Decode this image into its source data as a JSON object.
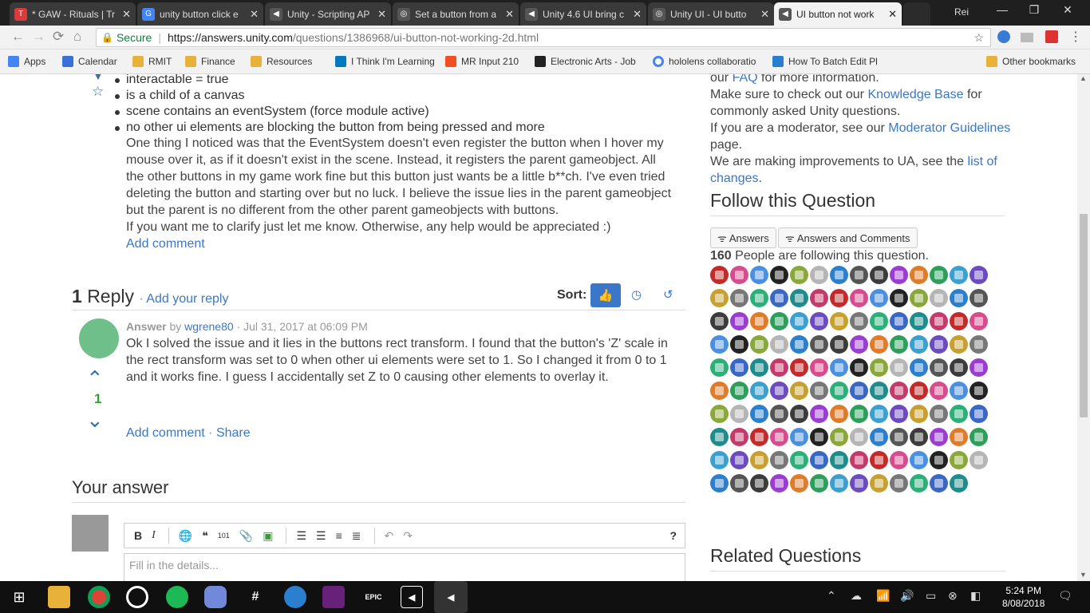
{
  "tabs": [
    {
      "label": "* GAW - Rituals | Tr",
      "color": "#d83b3b",
      "glyph": "T"
    },
    {
      "label": "unity button click e",
      "color": "#4285f4",
      "glyph": "G"
    },
    {
      "label": "Unity - Scripting AP",
      "color": "#555",
      "glyph": "◀"
    },
    {
      "label": "Set a button from a",
      "color": "#555",
      "glyph": "◎"
    },
    {
      "label": "Unity 4.6 UI bring c",
      "color": "#555",
      "glyph": "◀"
    },
    {
      "label": "Unity UI - UI butto",
      "color": "#555",
      "glyph": "◎"
    },
    {
      "label": "UI button not work",
      "color": "#555",
      "glyph": "◀"
    }
  ],
  "profile": "Rei",
  "omnibox": {
    "secure": "Secure",
    "url_host": "https://answers.unity.com",
    "url_path": "/questions/1386968/ui-button-not-working-2d.html"
  },
  "bookmarks": [
    {
      "label": "Apps",
      "kind": "apps"
    },
    {
      "label": "Calendar",
      "kind": "cal"
    },
    {
      "label": "RMIT",
      "kind": "folder"
    },
    {
      "label": "Finance",
      "kind": "folder"
    },
    {
      "label": "Resources",
      "kind": "folder"
    },
    {
      "label": "I Think I'm Learning",
      "kind": "trello"
    },
    {
      "label": "MR Input 210",
      "kind": "ms"
    },
    {
      "label": "Electronic Arts - Job",
      "kind": "ea"
    },
    {
      "label": "hololens collaboratio",
      "kind": "google"
    },
    {
      "label": "How To Batch Edit Pl",
      "kind": "plus"
    },
    {
      "label": "Other bookmarks",
      "kind": "folder"
    }
  ],
  "question": {
    "bullets": [
      "interactable = true",
      "is a child of a canvas",
      "scene contains an eventSystem (force module active)",
      "no other ui elements are blocking the button from being pressed and more"
    ],
    "body": "One thing I noticed was that the EventSystem doesn't even register the button when I hover my mouse over it, as if it doesn't exist in the scene. Instead, it registers the parent gameobject. All the other buttons in my game work fine but this button just wants be a little b**ch. I've even tried deleting the button and starting over but no luck. I believe the issue lies in the parent gameobject but the parent is no different from the other parent gameobjects with buttons.",
    "closing": "If you want me to clarify just let me know. Otherwise, any help would be appreciated :)",
    "add_comment": "Add comment"
  },
  "replies": {
    "count": "1",
    "label": "Reply",
    "add_reply": "Add your reply",
    "sort_label": "Sort:"
  },
  "answer": {
    "kind": "Answer",
    "by": "by",
    "author": "wgrene80",
    "date": "· Jul 31, 2017 at 06:09 PM",
    "text": "Ok I solved the issue and it lies in the buttons rect transform. I found that the button's 'Z' scale in the rect transform was set to 0 when other ui elements were set to 1. So I changed it from 0 to 1 and it works fine. I guess I accidentally set Z to 0 causing other elements to overlay it.",
    "votes": "1",
    "add_comment": "Add comment",
    "share": "Share"
  },
  "your_answer": {
    "heading": "Your answer",
    "placeholder": "Fill in the details..."
  },
  "sidebar": {
    "faq_pre": "our",
    "faq": "FAQ",
    "faq_post": "for more information.",
    "kb_pre": "Make sure to check out our",
    "kb": "Knowledge Base",
    "kb_post": "for commonly asked Unity questions.",
    "mod_pre": "If you are a moderator, see our",
    "mod": "Moderator Guidelines",
    "mod_post": "page.",
    "imp_pre": "We are making improvements to UA, see the",
    "imp": "list of changes",
    "imp_post": ".",
    "follow_heading": "Follow this Question",
    "btn_answers": "Answers",
    "btn_both": "Answers and Comments",
    "followers_count": "160",
    "followers_text": "People are following this question.",
    "related_heading": "Related Questions"
  },
  "avatar_colors": [
    "#2e9e5b",
    "#c8a030",
    "#3a66c4",
    "#c42a2a",
    "#222",
    "#2a7fcf",
    "#9b3dd1",
    "#3aa0d0",
    "#777",
    "#1e8c8c",
    "#d64c8c",
    "#8aa83a",
    "#555",
    "#e07b2a",
    "#6b4bbd",
    "#2bb07a",
    "#c23b6b",
    "#4a90e2",
    "#b5b5b5",
    "#3c3c3c"
  ],
  "taskbar": {
    "time": "5:24 PM",
    "date": "8/08/2018"
  }
}
